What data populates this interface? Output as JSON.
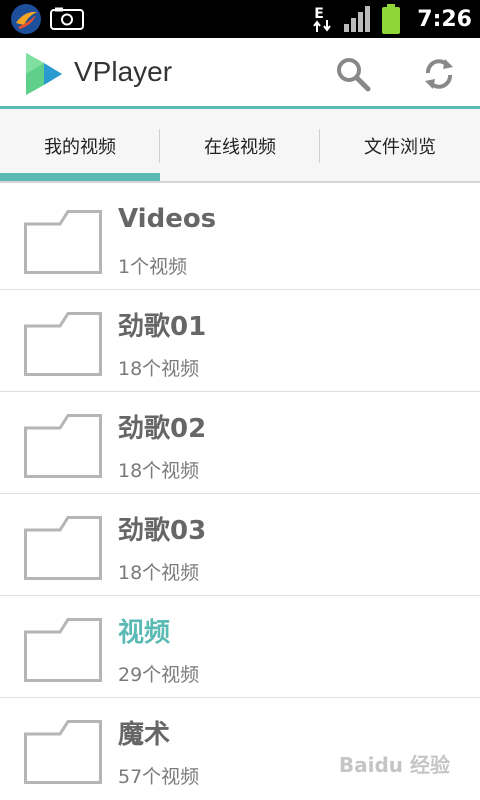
{
  "status_bar": {
    "time": "7:26",
    "network_label": "E",
    "icons": [
      "app-icon",
      "camera-icon",
      "data-network-icon",
      "signal-icon",
      "battery-icon"
    ]
  },
  "app_bar": {
    "title": "VPlayer",
    "icons": [
      "vplayer-logo-icon",
      "search-icon",
      "refresh-icon"
    ]
  },
  "tabs": [
    {
      "label": "我的视频",
      "selected": true
    },
    {
      "label": "在线视频",
      "selected": false
    },
    {
      "label": "文件浏览",
      "selected": false
    }
  ],
  "folders": [
    {
      "title": "Videos",
      "count": "1个视频",
      "highlighted": false
    },
    {
      "title": "劲歌01",
      "count": "18个视频",
      "highlighted": false
    },
    {
      "title": "劲歌02",
      "count": "18个视频",
      "highlighted": false
    },
    {
      "title": "劲歌03",
      "count": "18个视频",
      "highlighted": false
    },
    {
      "title": "视频",
      "count": "29个视频",
      "highlighted": true
    },
    {
      "title": "魔术",
      "count": "57个视频",
      "highlighted": false
    }
  ],
  "watermark": "Baidu 经验",
  "colors": {
    "accent": "#5bbbb4",
    "title_text": "#666666",
    "subtitle_text": "#7a7a7a",
    "status_bar": "#000000"
  }
}
